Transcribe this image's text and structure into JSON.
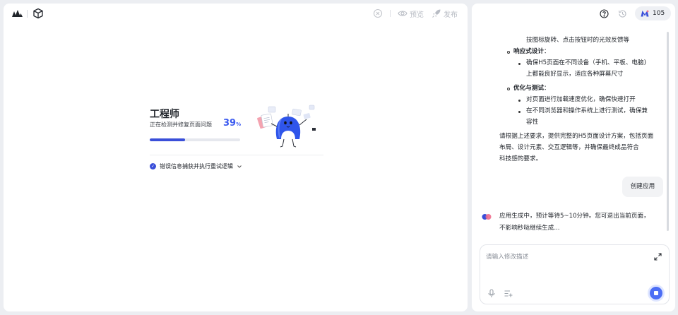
{
  "editor": {
    "toolbar": {
      "preview_label": "预览",
      "publish_label": "发布"
    },
    "progress_card": {
      "title": "工程师",
      "subtitle": "正在检测并修复页面问题",
      "percent_value": "39",
      "percent_sign": "%",
      "progress": 0.39,
      "status_text": "错误信息捕获并执行重试逻辑"
    }
  },
  "assistant": {
    "credits": "105",
    "messages": {
      "line_1": "技图标旋转、点击按钮时的光效反馈等",
      "responsive_heading": "响应式设计",
      "responsive_line_1": "确保H5页面在不同设备（手机、平板、电脑)",
      "responsive_line_2": "上都能良好显示，适应各种屏幕尺寸",
      "optimize_heading": "优化与测试",
      "optimize_item_1": "对页面进行加载速度优化，确保快速打开",
      "optimize_item_2_line_1": "在不同浏览器和操作系统上进行测试，确保兼",
      "optimize_item_2_line_2": "容性",
      "summary_line_1": "请根据上述要求，提供完整的H5页面设计方案，包括页面",
      "summary_line_2": "布局、设计元素、交互逻辑等，并确保最终成品符合",
      "summary_line_3": "科技感的要求。",
      "user_message": "创建应用",
      "ai_reply_line_1": "应用生成中，预计等待5~10分钟。您可退出当前页面，",
      "ai_reply_line_2": "不影响秒哒继续生成..."
    },
    "input": {
      "placeholder": "请输入修改描述"
    }
  },
  "colors": {
    "accent": "#3c5bf0",
    "stop_button": "#4c6ef5",
    "page_bg": "#eceef2"
  },
  "icons": [
    "logo-icon",
    "cube-icon",
    "close-circle-icon",
    "eye-icon",
    "rocket-icon",
    "help-icon",
    "history-icon",
    "credits-icon",
    "expand-icon",
    "mic-icon",
    "prompt-icon",
    "stop-icon",
    "check-icon",
    "chevron-down-icon"
  ]
}
